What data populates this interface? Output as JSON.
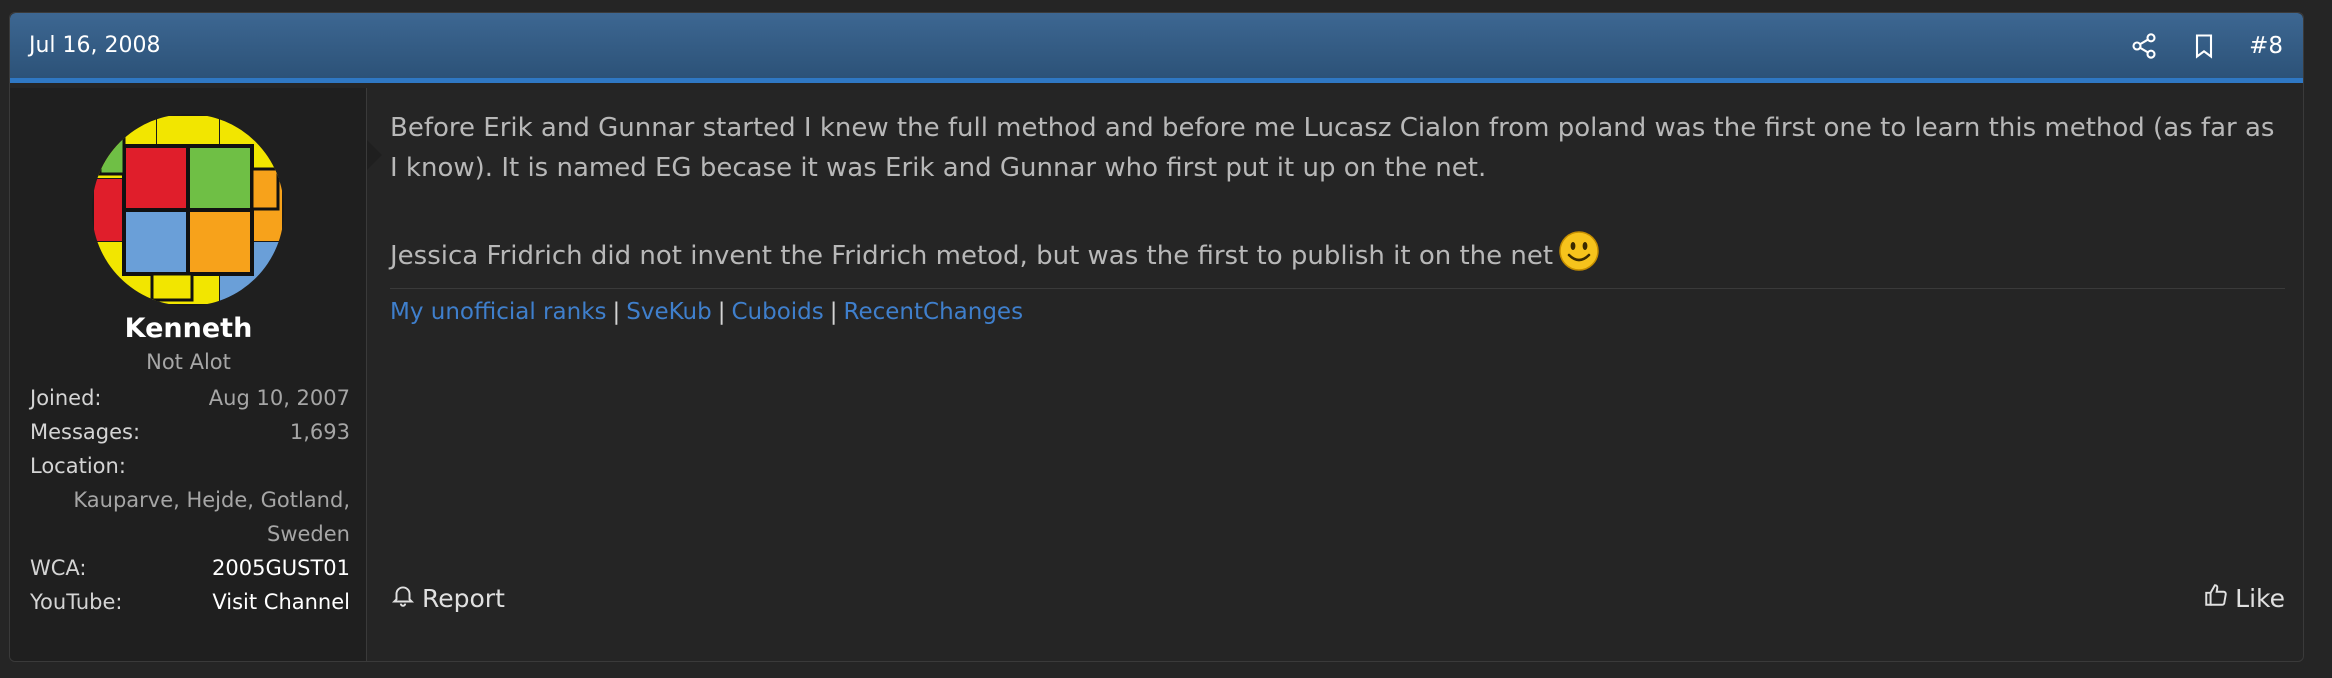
{
  "post": {
    "date": "Jul 16, 2008",
    "number": "#8",
    "share_icon": "share-icon",
    "bookmark_icon": "bookmark-icon"
  },
  "user": {
    "name": "Kenneth",
    "title": "Not Alot",
    "stats": {
      "joined_label": "Joined:",
      "joined_value": "Aug 10, 2007",
      "messages_label": "Messages:",
      "messages_value": "1,693",
      "location_label": "Location:",
      "location_line1": "Kauparve, Hejde, Gotland,",
      "location_line2": "Sweden",
      "wca_label": "WCA:",
      "wca_value": "2005GUST01",
      "youtube_label": "YouTube:",
      "youtube_value": "Visit Channel"
    }
  },
  "message": {
    "paragraph1": "Before Erik and Gunnar started I knew the full method and before me Lucasz Cialon from poland was the first one to learn this method (as far as I know). It is named EG becase it was Erik and Gunnar who first put it up on the net.",
    "paragraph2": "Jessica Fridrich did not invent the Fridrich metod, but was the first to publish it on the net"
  },
  "signature": {
    "links": [
      "My unofficial ranks",
      "SveKub",
      "Cuboids",
      "RecentChanges"
    ],
    "separator": "|"
  },
  "actions": {
    "report_label": "Report",
    "like_label": "Like"
  },
  "colors": {
    "header_top": "#3d6792",
    "header_bottom": "#2c5278",
    "accent_line": "#2f78c4",
    "link": "#3f7fcc"
  }
}
